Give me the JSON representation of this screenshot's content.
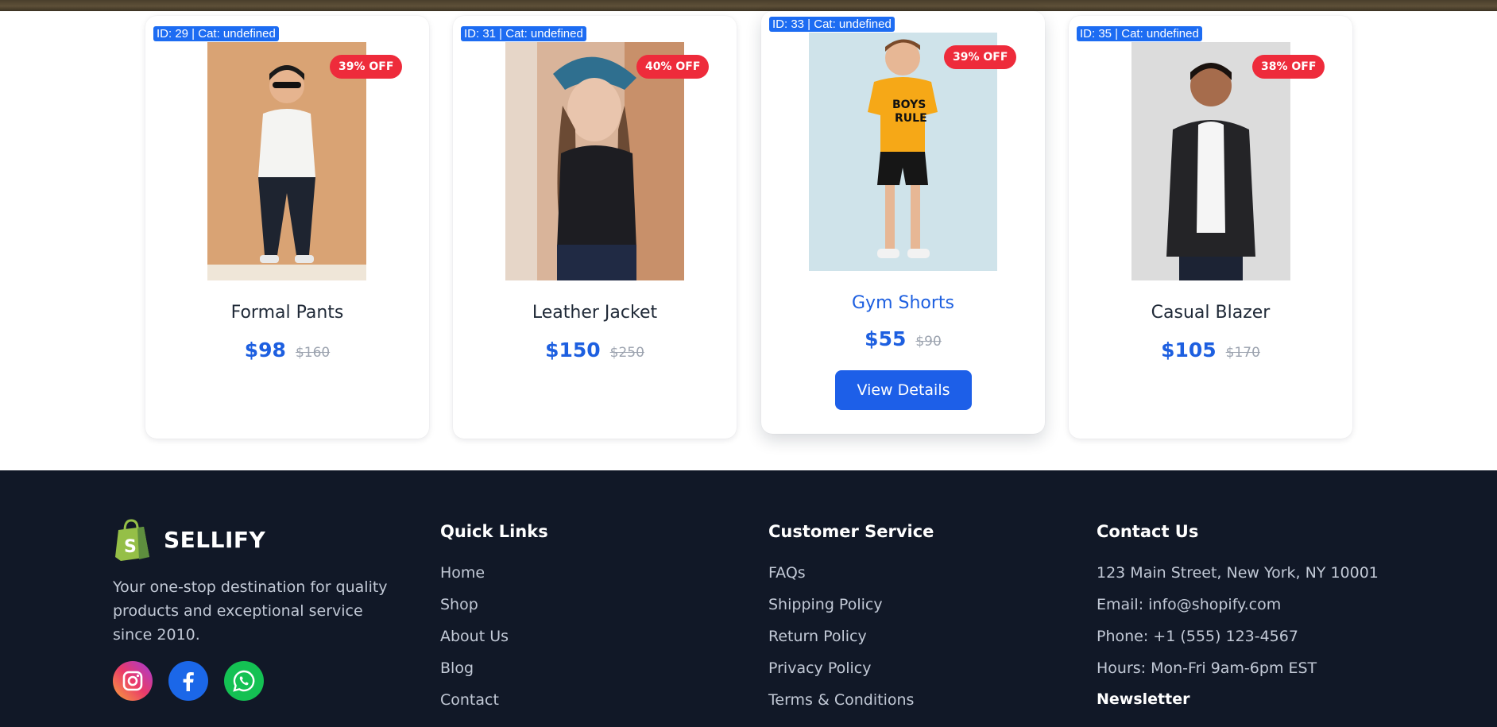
{
  "products": [
    {
      "id_label": "ID: 29 | Cat: undefined",
      "discount": "39% OFF",
      "name": "Formal Pants",
      "price": "$98",
      "old_price": "$160"
    },
    {
      "id_label": "ID: 31 | Cat: undefined",
      "discount": "40% OFF",
      "name": "Leather Jacket",
      "price": "$150",
      "old_price": "$250"
    },
    {
      "id_label": "ID: 33 | Cat: undefined",
      "discount": "39% OFF",
      "name": "Gym Shorts",
      "price": "$55",
      "old_price": "$90",
      "button": "View Details"
    },
    {
      "id_label": "ID: 35 | Cat: undefined",
      "discount": "38% OFF",
      "name": "Casual Blazer",
      "price": "$105",
      "old_price": "$170"
    }
  ],
  "footer": {
    "brand": "SELLIFY",
    "tagline": "Your one-stop destination for quality products and exceptional service since 2010.",
    "social": [
      "instagram-icon",
      "facebook-icon",
      "whatsapp-icon"
    ],
    "quick_links": {
      "title": "Quick Links",
      "items": [
        "Home",
        "Shop",
        "About Us",
        "Blog",
        "Contact"
      ]
    },
    "customer_service": {
      "title": "Customer Service",
      "items": [
        "FAQs",
        "Shipping Policy",
        "Return Policy",
        "Privacy Policy",
        "Terms & Conditions"
      ]
    },
    "contact": {
      "title": "Contact Us",
      "items": [
        "123 Main Street, New York, NY 10001",
        "Email: info@shopify.com",
        "Phone: +1 (555) 123-4567",
        "Hours: Mon-Fri 9am-6pm EST"
      ],
      "newsletter": "Newsletter"
    }
  },
  "colors": {
    "accent": "#1d5fe0",
    "discount": "#ee2b3b",
    "footer_bg": "#111827",
    "id_tag": "#1d6cf2"
  }
}
